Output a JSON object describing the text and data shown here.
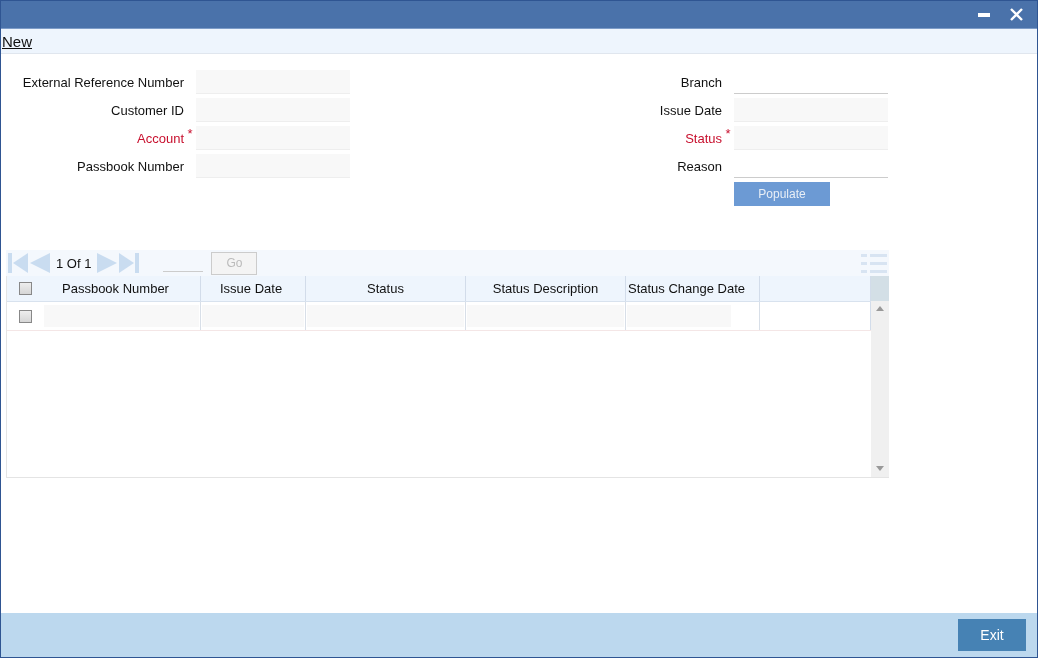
{
  "action_bar": {
    "link": "New"
  },
  "form": {
    "left": [
      {
        "label": "External Reference Number",
        "required": false,
        "kind": "filled"
      },
      {
        "label": "Customer ID",
        "required": false,
        "kind": "filled"
      },
      {
        "label": "Account",
        "required": true,
        "kind": "filled"
      },
      {
        "label": "Passbook Number",
        "required": false,
        "kind": "filled"
      }
    ],
    "right": [
      {
        "label": "Branch",
        "required": false,
        "kind": "underline"
      },
      {
        "label": "Issue Date",
        "required": false,
        "kind": "filled"
      },
      {
        "label": "Status",
        "required": true,
        "kind": "filled"
      },
      {
        "label": "Reason",
        "required": false,
        "kind": "underline"
      }
    ],
    "required_mark": "*",
    "populate_button": {
      "label": "Populate",
      "disabled": true
    }
  },
  "grid": {
    "pager": {
      "text": "1 Of 1",
      "go": {
        "label": "Go",
        "disabled": true
      }
    },
    "select_all": {
      "checked": false
    },
    "columns": [
      "Passbook Number",
      "Issue Date",
      "Status",
      "Status Description",
      "Status Change Date"
    ],
    "rows": [
      {
        "checked": false
      }
    ]
  },
  "footer": {
    "exit_button": "Exit"
  }
}
